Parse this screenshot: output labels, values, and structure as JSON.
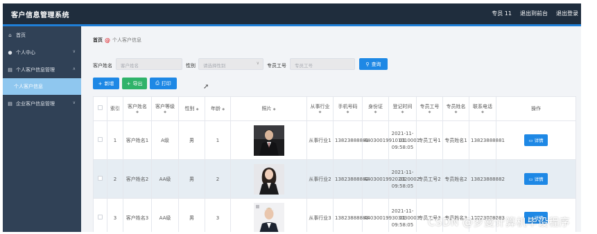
{
  "app": {
    "title": "客户信息管理系统"
  },
  "header": {
    "user": "专员 11",
    "back_label": "退出到前台",
    "logout_label": "退出登录"
  },
  "sidebar": {
    "items": [
      {
        "label": "首页",
        "icon": "home-icon"
      },
      {
        "label": "个人中心",
        "icon": "user-icon"
      },
      {
        "label": "个人客户信息管理",
        "icon": "document-icon"
      },
      {
        "label": "个人客户信息",
        "icon": ""
      },
      {
        "label": "企业客户信息管理",
        "icon": "document-icon"
      }
    ]
  },
  "breadcrumb": {
    "home": "首页",
    "separator": "@",
    "current": "个人客户信息"
  },
  "search": {
    "name_label": "客户姓名",
    "name_placeholder": "客户姓名",
    "gender_label": "性别",
    "gender_placeholder": "请选择性别",
    "staff_label": "专员工号",
    "staff_placeholder": "专员工号",
    "query_label": "查询"
  },
  "toolbar": {
    "add_label": "新增",
    "export_label": "导出",
    "print_label": "打印"
  },
  "table": {
    "headers": [
      "索引",
      "客户姓名",
      "客户等级",
      "性别",
      "年龄",
      "照片",
      "从事行业",
      "手机号码",
      "身份证",
      "登记时间",
      "专员工号",
      "专员姓名",
      "联系电话",
      "操作"
    ],
    "rows": [
      {
        "index": "1",
        "name": "客户姓名1",
        "level": "A级",
        "gender": "男",
        "age": "1",
        "industry": "从事行业1",
        "phone": "13823888881",
        "id_card": "440300199101010001",
        "reg_time": "2021-11-01 09:58:05",
        "staff_no": "专员工号1",
        "staff_name": "专员姓名1",
        "contact": "13823888881",
        "action": "详情"
      },
      {
        "index": "2",
        "name": "客户姓名2",
        "level": "AA级",
        "gender": "男",
        "age": "2",
        "industry": "从事行业2",
        "phone": "13823888882",
        "id_card": "440300199202020002",
        "reg_time": "2021-11-01 09:58:05",
        "staff_no": "专员工号2",
        "staff_name": "专员姓名2",
        "contact": "13823888882",
        "action": "详情"
      },
      {
        "index": "3",
        "name": "客户姓名3",
        "level": "AA级",
        "gender": "男",
        "age": "3",
        "industry": "从事行业3",
        "phone": "13823888883",
        "id_card": "440300199303030003",
        "reg_time": "2021-11-01 09:58:05",
        "staff_no": "专员工号3",
        "staff_name": "专员姓名3",
        "contact": "13823888883",
        "action": "详情"
      }
    ]
  },
  "watermark": "CSDN @罗曼计算机毕设程序",
  "colors": {
    "header_bg": "#1f2d3d",
    "sidebar_bg": "#304156",
    "accent": "#1e88e5",
    "active_menu": "#8fc7ef",
    "export_green": "#2fb36a"
  }
}
